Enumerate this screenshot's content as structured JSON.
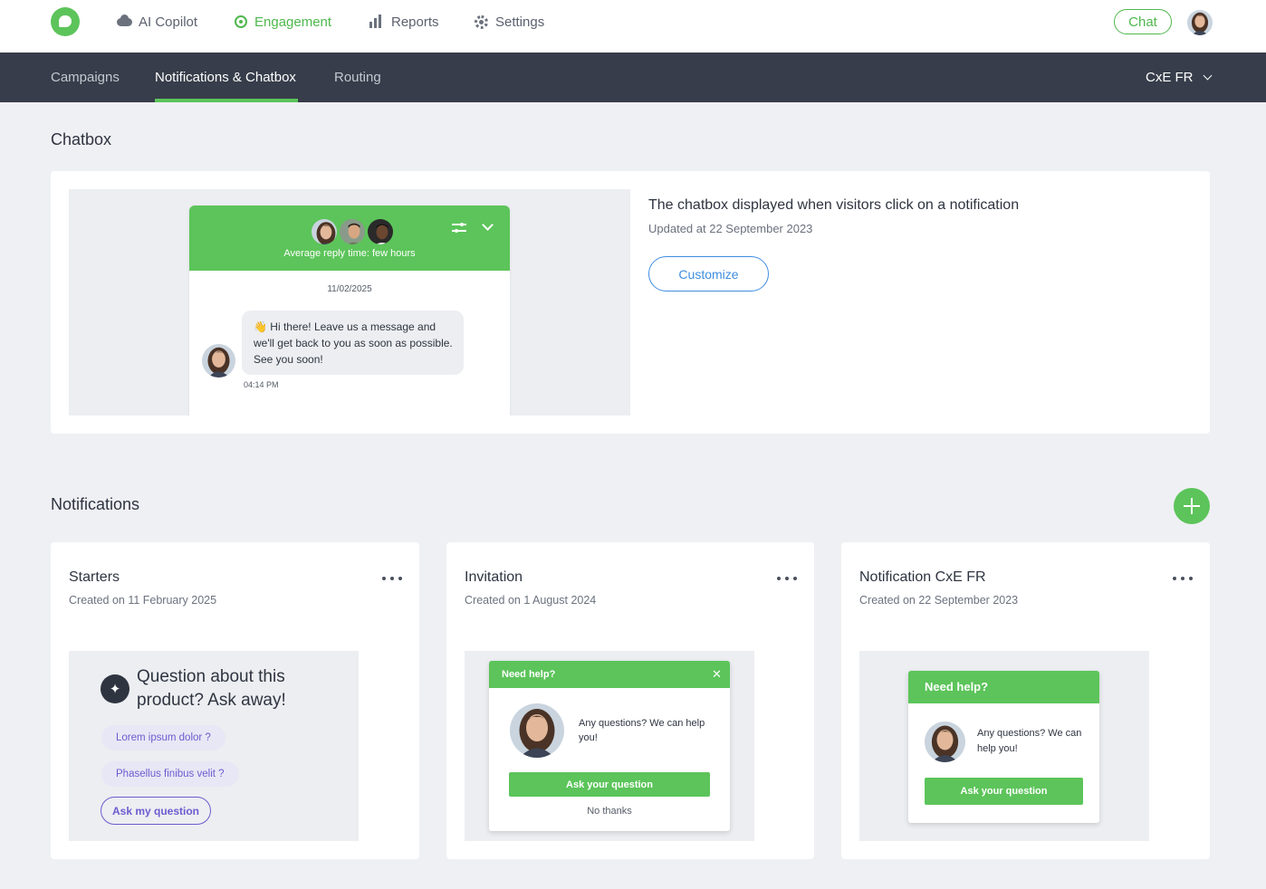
{
  "topnav": {
    "items": [
      {
        "label": "AI Copilot",
        "icon": "cloud-icon"
      },
      {
        "label": "Engagement",
        "icon": "target-icon"
      },
      {
        "label": "Reports",
        "icon": "bar-chart-icon"
      },
      {
        "label": "Settings",
        "icon": "gear-icon"
      }
    ],
    "chat_label": "Chat",
    "accent": "#5cc45a"
  },
  "subnav": {
    "tabs": [
      "Campaigns",
      "Notifications & Chatbox",
      "Routing"
    ],
    "active_tab": "Notifications & Chatbox",
    "workspace": "CxE FR"
  },
  "chatbox": {
    "section_title": "Chatbox",
    "preview": {
      "reply_time": "Average reply time: few hours",
      "date": "11/02/2025",
      "message": "👋 Hi there! Leave us a message and we'll get back to you as soon as possible. See you soon!",
      "time": "04:14 PM"
    },
    "description": "The chatbox displayed when visitors click on a notification",
    "updated": "Updated at 22 September 2023",
    "customize_label": "Customize"
  },
  "notifications": {
    "section_title": "Notifications",
    "cards": [
      {
        "title": "Starters",
        "created": "Created on 11 February 2025",
        "question": "Question about this product? Ask away!",
        "chips": [
          "Lorem ipsum dolor ?",
          "Phasellus finibus velit ?"
        ],
        "ask_label": "Ask my question"
      },
      {
        "title": "Invitation",
        "created": "Created on 1 August 2024",
        "popup_title": "Need help?",
        "popup_text": "Any questions? We can help you!",
        "popup_button": "Ask your question",
        "popup_dismiss": "No thanks"
      },
      {
        "title": "Notification CxE FR",
        "created": "Created on 22 September 2023",
        "popup_title": "Need help?",
        "popup_text": "Any questions? We can help you!",
        "popup_button": "Ask your question"
      }
    ]
  }
}
